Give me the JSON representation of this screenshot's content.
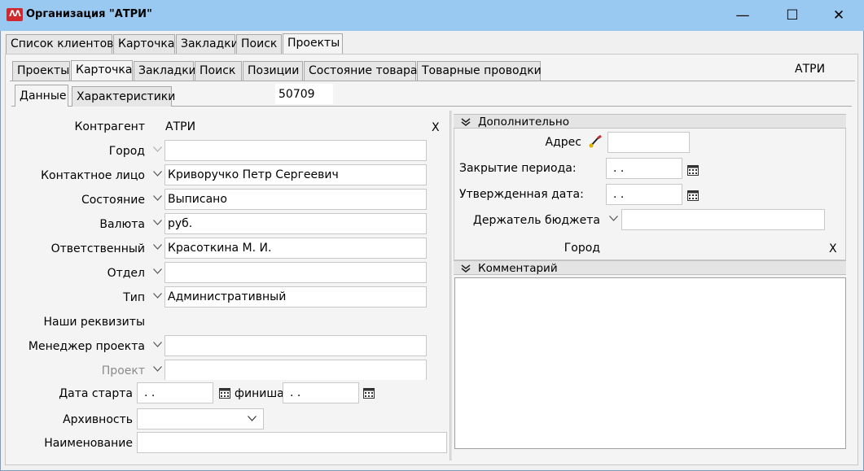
{
  "window": {
    "title": "Организация \"АТРИ\"",
    "minimize": "—",
    "maximize": "☐",
    "close": "✕",
    "logo_text": "ᐱᐱ"
  },
  "top_tabs": [
    {
      "label": "Список клиентов"
    },
    {
      "label": "Карточка"
    },
    {
      "label": "Закладки"
    },
    {
      "label": "Поиск"
    },
    {
      "label": "Проекты"
    }
  ],
  "sub_tabs": [
    {
      "label": "Проекты"
    },
    {
      "label": "Карточка"
    },
    {
      "label": "Закладки"
    },
    {
      "label": "Поиск"
    },
    {
      "label": "Позиции"
    },
    {
      "label": "Состояние товара"
    },
    {
      "label": "Товарные проводки"
    }
  ],
  "org_name": "АТРИ",
  "card_tabs": [
    {
      "label": "Данные"
    },
    {
      "label": "Характеристики"
    }
  ],
  "record_id": "50709",
  "form": {
    "counterparty_label": "Контрагент",
    "counterparty_value": "АТРИ",
    "counterparty_clear": "X",
    "city_label": "Город",
    "city_value": "",
    "contact_label": "Контактное лицо",
    "contact_value": "Криворучко Петр Сергеевич",
    "state_label": "Состояние",
    "state_value": "Выписано",
    "currency_label": "Валюта",
    "currency_value": "руб.",
    "responsible_label": "Ответственный",
    "responsible_value": "Красоткина М. И.",
    "department_label": "Отдел",
    "department_value": "",
    "type_label": "Тип",
    "type_value": "Административный",
    "our_details_label": "Наши реквизиты",
    "manager_label": "Менеджер проекта",
    "manager_value": "",
    "project_label": "Проект",
    "project_value": "",
    "start_label": "Дата старта",
    "start_value": " .  .",
    "finish_label": "финиша:",
    "finish_value": " .  .",
    "archive_label": "Архивность",
    "archive_value": "",
    "name_label": "Наименование",
    "name_value": ""
  },
  "extra": {
    "section_title": "Дополнительно",
    "address_label": "Адрес",
    "address_value": "",
    "close_period_label": "Закрытие периода:",
    "close_period_value": " .  .",
    "approved_label": "Утвержденная дата:",
    "approved_value": " .  .",
    "budget_holder_label": "Держатель бюджета",
    "budget_holder_value": "",
    "city_label": "Город",
    "city_clear": "X"
  },
  "comment": {
    "section_title": "Комментарий",
    "value": ""
  },
  "colors": {
    "titlebar": "#99c8f0",
    "logo": "#d0282f"
  }
}
